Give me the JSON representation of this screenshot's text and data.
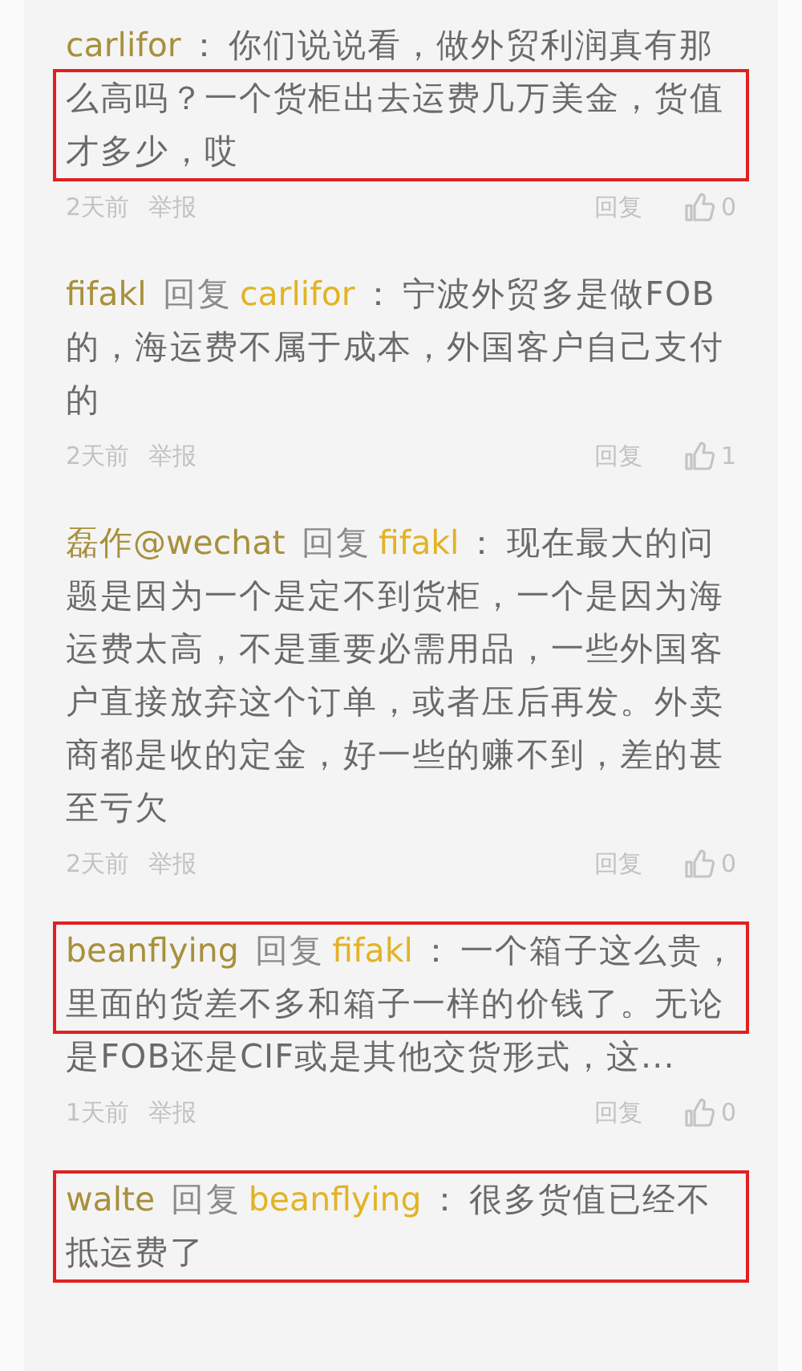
{
  "comments": [
    {
      "author": "carlifor",
      "colon": "：",
      "lines": [
        {
          "text": "你们说说看，做外贸利润真有那",
          "boxed": false
        },
        {
          "text": "么高吗？一个货柜出去运费几万美金，货值",
          "boxed": true
        },
        {
          "text": "才多少，哎",
          "boxed": true
        }
      ],
      "footer": {
        "time": "2天前",
        "report": "举报",
        "reply": "回复",
        "likes": "0"
      }
    },
    {
      "author": "fifakl",
      "reply_label": "回复",
      "reply_to": "carlifor",
      "colon": "：",
      "lines": [
        {
          "text": "宁波外贸多是做FOB",
          "boxed": false
        },
        {
          "text": "的，海运费不属于成本，外国客户自己支付",
          "boxed": false
        },
        {
          "text": "的",
          "boxed": false
        }
      ],
      "footer": {
        "time": "2天前",
        "report": "举报",
        "reply": "回复",
        "likes": "1"
      }
    },
    {
      "author": "磊作@wechat",
      "reply_label": "回复",
      "reply_to": "fifakl",
      "colon": "：",
      "lines": [
        {
          "text": "现在最大的问",
          "boxed": false
        },
        {
          "text": "题是因为一个是定不到货柜，一个是因为海",
          "boxed": false
        },
        {
          "text": "运费太高，不是重要必需用品，一些外国客",
          "boxed": false
        },
        {
          "text": "户直接放弃这个订单，或者压后再发。外卖",
          "boxed": false
        },
        {
          "text": "商都是收的定金，好一些的赚不到，差的甚",
          "boxed": false
        },
        {
          "text": "至亏欠",
          "boxed": false
        }
      ],
      "footer": {
        "time": "2天前",
        "report": "举报",
        "reply": "回复",
        "likes": "0"
      }
    },
    {
      "author": "beanflying",
      "reply_label": "回复",
      "reply_to": "fifakl",
      "colon": "：",
      "lines": [
        {
          "text": "一个箱子这么贵，",
          "boxed": true
        },
        {
          "text": "里面的货差不多和箱子一样的价钱了。无论",
          "boxed": true
        },
        {
          "text": "是FOB还是CIF或是其他交货形式，这...",
          "boxed": false
        }
      ],
      "footer": {
        "time": "1天前",
        "report": "举报",
        "reply": "回复",
        "likes": "0"
      }
    },
    {
      "author": "walte",
      "reply_label": "回复",
      "reply_to": "beanflying",
      "colon": "：",
      "lines": [
        {
          "text": "很多货值已经不",
          "boxed": true
        },
        {
          "text": "抵运费了",
          "boxed": true
        }
      ]
    }
  ]
}
